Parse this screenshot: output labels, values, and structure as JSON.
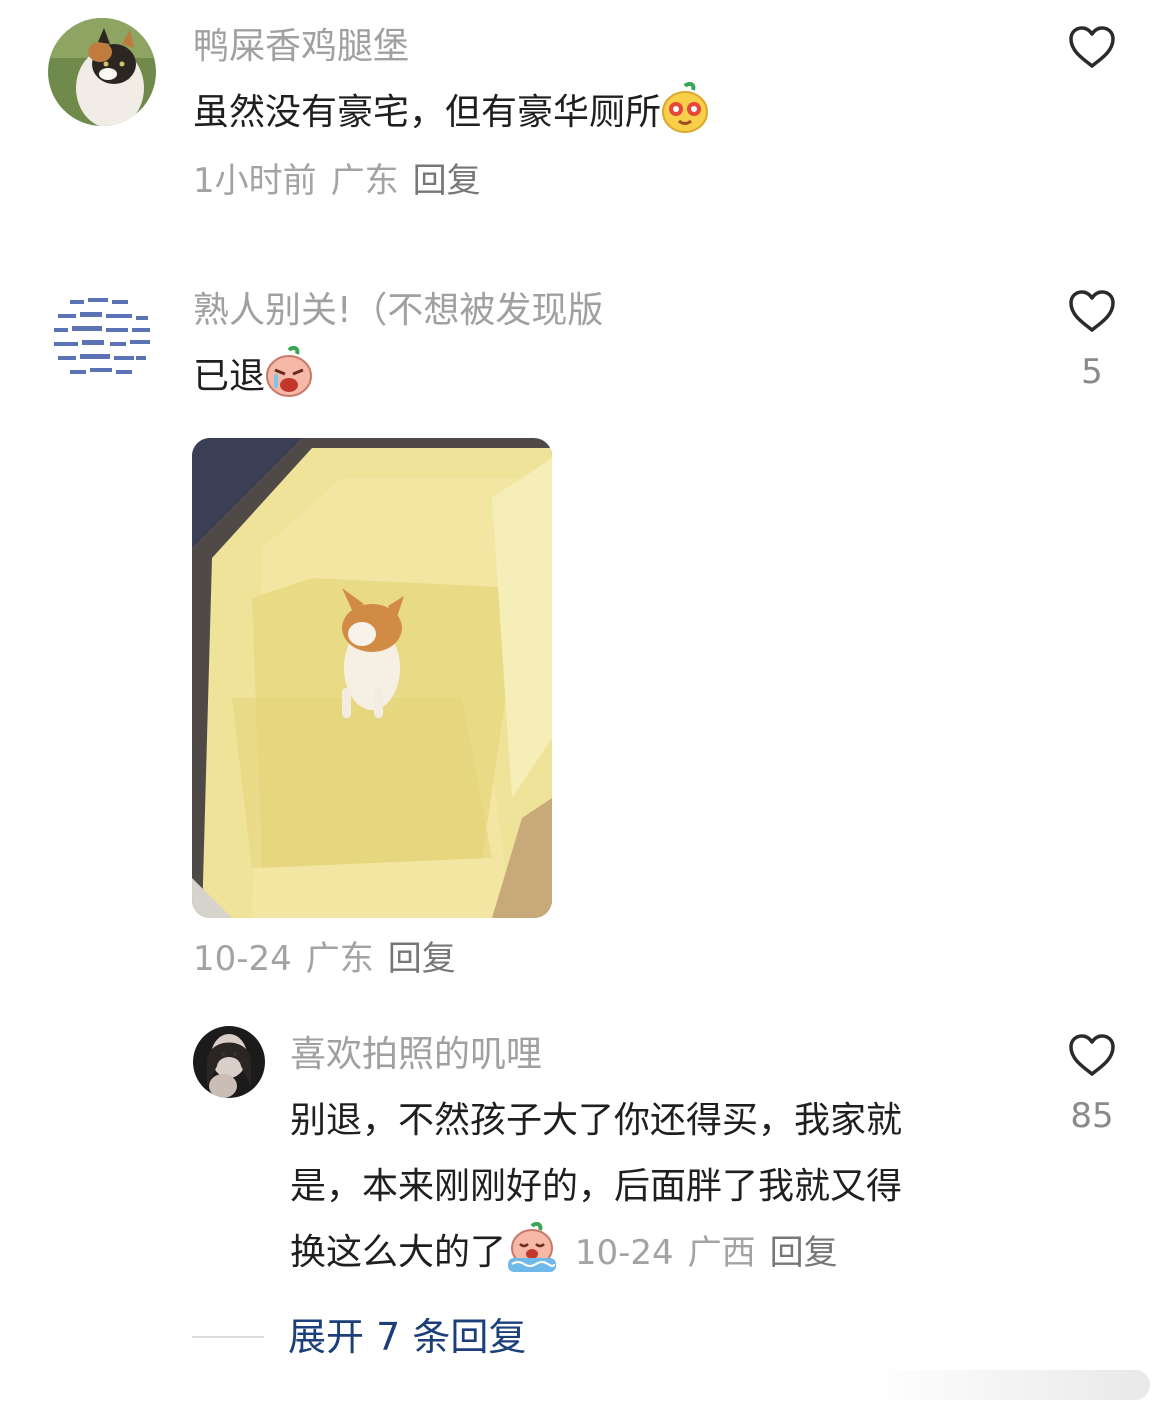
{
  "comments": [
    {
      "username": "鸭屎香鸡腿堡",
      "text": "虽然没有豪宅，但有豪华厕所",
      "emoji": "yellow-face-emoji",
      "time": "1小时前",
      "location": "广东",
      "reply": "回复"
    },
    {
      "username": "熟人别关!（不想被发现版",
      "text": "已退",
      "emoji": "crying-face-emoji",
      "likes": "5",
      "time": "10-24",
      "location": "广东",
      "reply": "回复",
      "photo": "cat-in-yellow-litter-box"
    }
  ],
  "reply": {
    "username": "喜欢拍照的叽哩",
    "text_line1": "别退，不然孩子大了你还得买，我家就",
    "text_line2": "是，本来刚刚好的，后面胖了我就又得",
    "text_line3": "换这么大的了",
    "emoji": "sobbing-face-emoji",
    "likes": "85",
    "time": "10-24",
    "location": "广西",
    "reply_label": "回复"
  },
  "expand_replies": "展开 7 条回复",
  "colors": {
    "username": "#a0a0a0",
    "text": "#1f1f1f",
    "meta": "#a3a3a3",
    "link": "#1c3f7a"
  }
}
